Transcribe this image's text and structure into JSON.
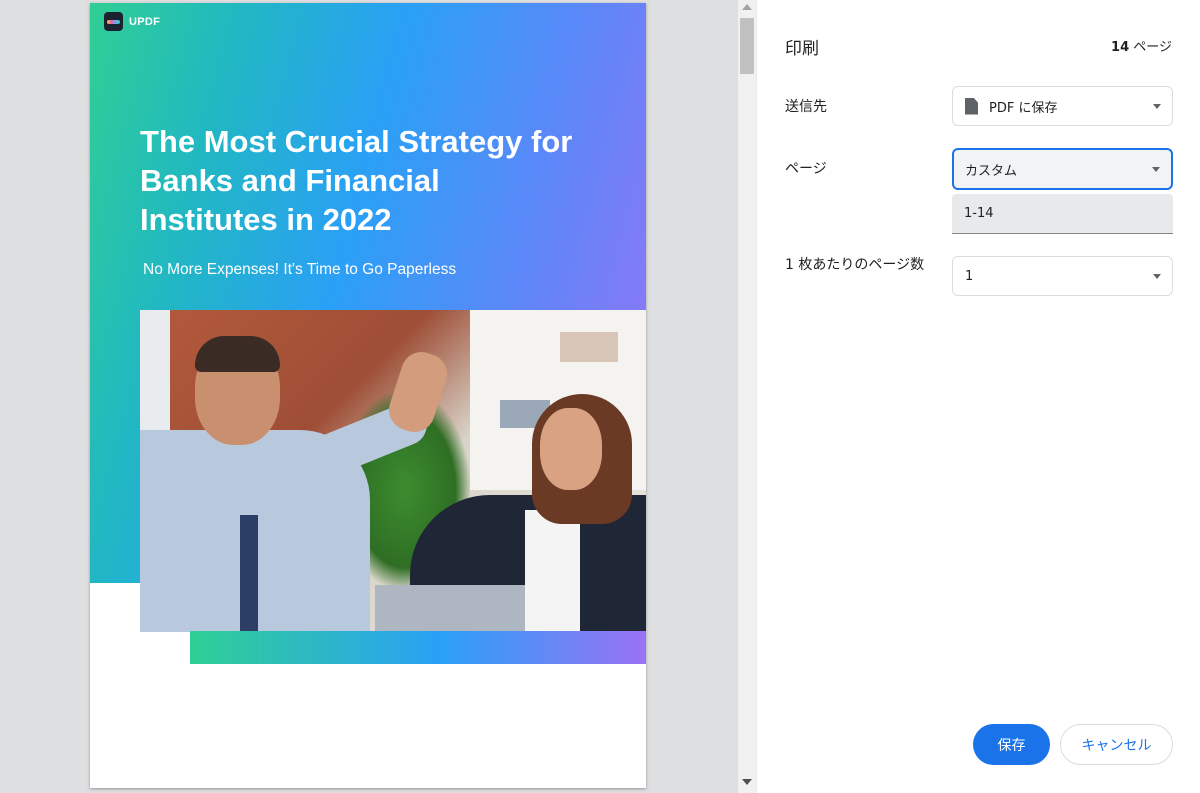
{
  "document": {
    "brand": "UPDF",
    "title": "The Most Crucial Strategy for Banks and Financial Institutes in 2022",
    "subtitle": "No More Expenses! It's Time to Go Paperless"
  },
  "print_panel": {
    "title": "印刷",
    "page_count_number": "14",
    "page_count_suffix": " ページ",
    "destination": {
      "label": "送信先",
      "value": "PDF に保存"
    },
    "pages": {
      "label": "ページ",
      "value": "カスタム",
      "range_value": "1-14"
    },
    "pages_per_sheet": {
      "label": "1 枚あたりのページ数",
      "value": "1"
    },
    "save_label": "保存",
    "cancel_label": "キャンセル"
  },
  "colors": {
    "accent": "#1a73e8",
    "gradient_start": "#2fcf94",
    "gradient_mid": "#2aa0f6",
    "gradient_end": "#9a72f4"
  }
}
